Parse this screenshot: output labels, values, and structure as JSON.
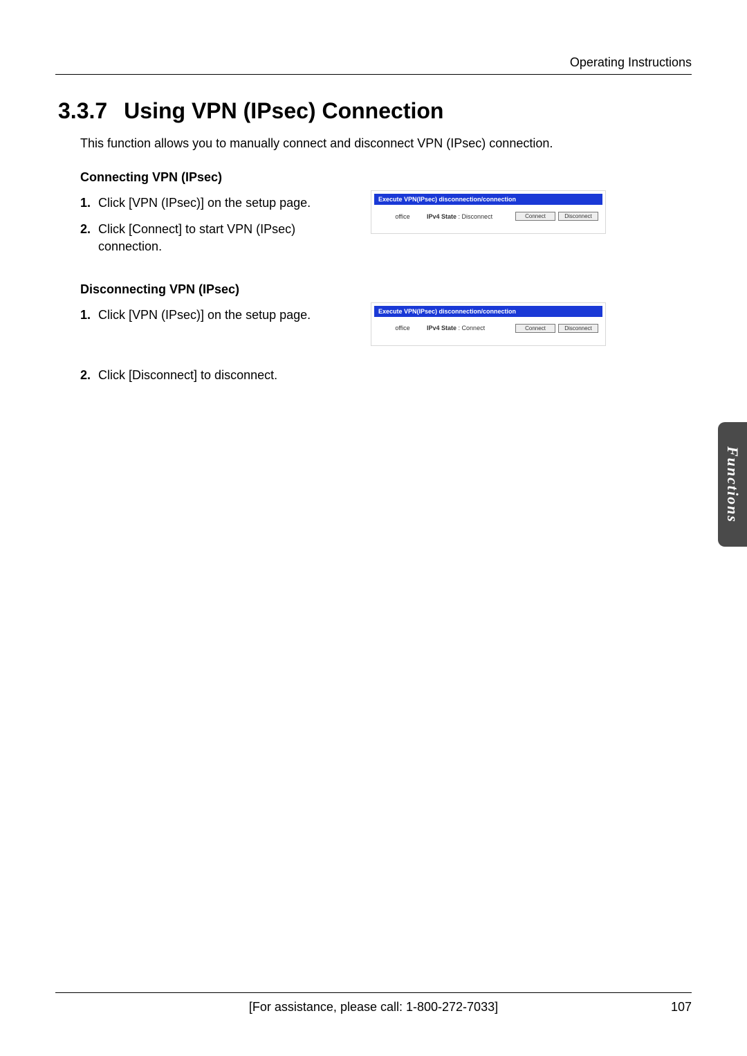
{
  "header": {
    "running_head": "Operating Instructions"
  },
  "section": {
    "number": "3.3.7",
    "title": "Using VPN (IPsec) Connection",
    "intro": "This function allows you to manually connect and disconnect VPN (IPsec) connection."
  },
  "connecting": {
    "heading": "Connecting VPN (IPsec)",
    "steps": [
      "Click [VPN (IPsec)] on the setup page.",
      "Click [Connect] to start VPN (IPsec) connection."
    ],
    "screenshot": {
      "bar": "Execute VPN(IPsec) disconnection/connection",
      "name": "office",
      "state_label": "IPv4 State",
      "state_value": "Disconnect",
      "btn_connect": "Connect",
      "btn_disconnect": "Disconnect"
    }
  },
  "disconnecting": {
    "heading": "Disconnecting VPN (IPsec)",
    "step1": "Click [VPN (IPsec)] on the setup page.",
    "step2": "Click [Disconnect] to disconnect.",
    "screenshot": {
      "bar": "Execute VPN(IPsec) disconnection/connection",
      "name": "office",
      "state_label": "IPv4 State",
      "state_value": "Connect",
      "btn_connect": "Connect",
      "btn_disconnect": "Disconnect"
    }
  },
  "side_tab": "Functions",
  "footer": {
    "assist": "[For assistance, please call: 1-800-272-7033]",
    "page_number": "107"
  },
  "step_numbers": {
    "n1": "1.",
    "n2": "2."
  }
}
